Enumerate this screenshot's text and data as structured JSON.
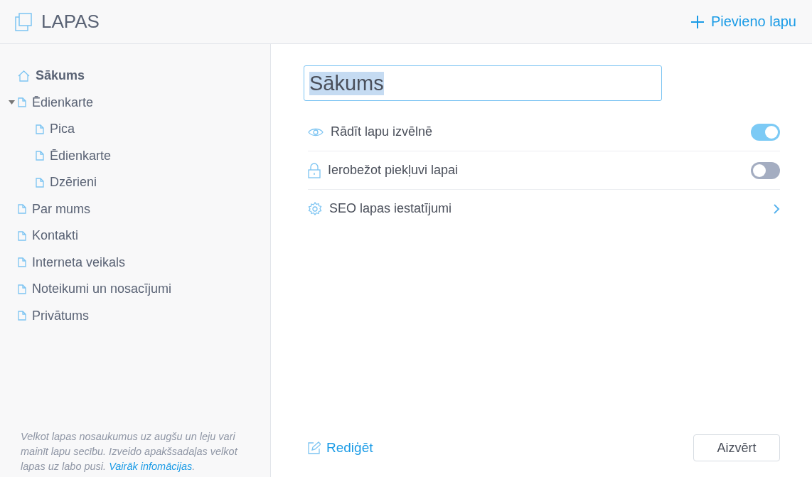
{
  "header": {
    "title": "LAPAS",
    "add_button": "Pievieno lapu"
  },
  "sidebar": {
    "items": [
      {
        "label": "Sākums",
        "kind": "home",
        "selected": true
      },
      {
        "label": "Ēdienkarte",
        "kind": "page",
        "selected": false,
        "expanded": true,
        "children": [
          {
            "label": "Pica",
            "kind": "page",
            "selected": false
          },
          {
            "label": "Ēdienkarte",
            "kind": "page",
            "selected": false
          },
          {
            "label": "Dzērieni",
            "kind": "page",
            "selected": false
          }
        ]
      },
      {
        "label": "Par mums",
        "kind": "page",
        "selected": false
      },
      {
        "label": "Kontakti",
        "kind": "page",
        "selected": false
      },
      {
        "label": "Interneta veikals",
        "kind": "page",
        "selected": false
      },
      {
        "label": "Noteikumi un nosacījumi",
        "kind": "page",
        "selected": false
      },
      {
        "label": "Privātums",
        "kind": "page",
        "selected": false
      }
    ],
    "hint": "Velkot lapas nosaukumus uz augšu un leju vari mainīt lapu secību. Izveido apakšsadaļas velkot lapas uz labo pusi.",
    "hint_link": "Vairāk infomācijas",
    "hint_end": "."
  },
  "editor": {
    "title_field": {
      "value": "Sākums",
      "text_selected": true
    },
    "settings": [
      {
        "kind": "toggle",
        "label": "Rādīt lapu izvēlnē",
        "on": true
      },
      {
        "kind": "toggle",
        "label": "Ierobežot piekļuvi lapai",
        "on": false
      },
      {
        "kind": "link",
        "label": "SEO lapas iestatījumi"
      }
    ],
    "edit_link": "Rediģēt",
    "close_button": "Aizvērt"
  }
}
